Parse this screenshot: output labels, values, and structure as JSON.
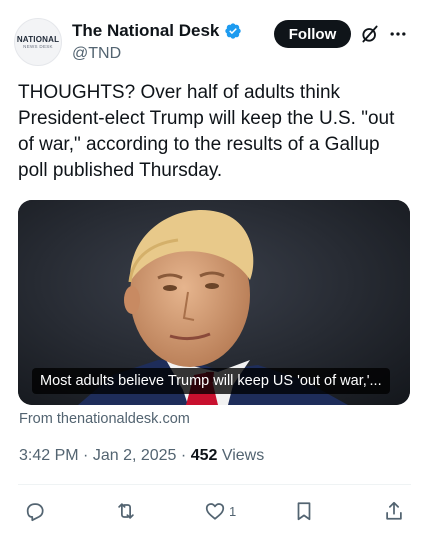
{
  "header": {
    "avatar_line1": "NATIONAL",
    "avatar_line2": "NEWS DESK",
    "display_name": "The National Desk",
    "handle": "@TND",
    "follow_label": "Follow"
  },
  "tweet": {
    "text": "THOUGHTS? Over half of adults think President-elect Trump will keep the U.S. \"out of war,\" according to the results of a Gallup poll published Thursday."
  },
  "media": {
    "caption": "Most adults believe Trump will keep US 'out of war,'..."
  },
  "source": {
    "text": "From thenationaldesk.com"
  },
  "meta": {
    "time": "3:42 PM",
    "separator": "·",
    "date": "Jan 2, 2025",
    "views_count": "452",
    "views_label": "Views"
  },
  "actions": {
    "reply_icon": "reply-icon",
    "retweet_icon": "retweet-icon",
    "like_icon": "heart-icon",
    "like_count": "1",
    "bookmark_icon": "bookmark-icon",
    "share_icon": "share-icon"
  },
  "colors": {
    "text_primary": "#0f1419",
    "text_secondary": "#536471",
    "verified_blue": "#1d9bf0",
    "follow_bg": "#0f1419"
  }
}
